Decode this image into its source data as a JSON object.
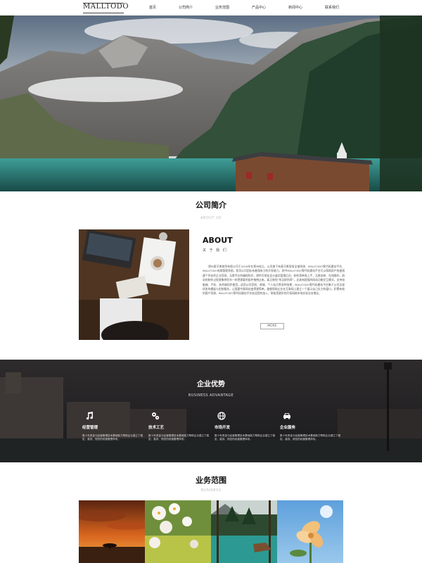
{
  "header": {
    "logo": "MALLTODO",
    "nav": [
      "首页",
      "公司简介",
      "业务范围",
      "产品中心",
      "新闻中心",
      "联系我们"
    ]
  },
  "about": {
    "title": "公司简介",
    "subtitle": "ABOUT US",
    "heading": "ABOUT",
    "heading_cn": "关 于 我 们",
    "body": "郑州麦可希商贸有限公司于2018年在郑州成立，公司旗下有麦可希智慧全域系统、MALLTODO零代码建站平台、MALLTODO电商管理系统。我司公司团队有着强有力的开发能力，其中MALLTODO零代码建站平台可以帮助用户快速搭建个性化的企业官网，无需专业的编程知识，提供可视化设计器及管理后台，制作简单易上手，无需安装、在线操作，网站的制作过程就像拼积木一样把需要的组件拖拽过来，真正做到“所见即所得”，还具有超强的网站功能交互模式，支持电脑端、手机、多终端同步使用，适用公司官网、商城、个人站点等多种场景；MALLTODO零代码建站平台集于公司总部研发的模板与定制服务，让搭建专属网站变得更简单。能够帮助企业在互联网上建立一个展示自己实力的窗口，积累有效的客户资源，MALLTODO零代码建站平台欢迎您的加入，帮助您更好的开拓网络市场实现业务增长。",
    "more": "MORE"
  },
  "advantage": {
    "title": "企业优势",
    "subtitle": "BUSINESS ADVANTAGE",
    "items": [
      {
        "icon": "music-note-icon",
        "name": "经营管理",
        "desc": "数十年资金与经营管理技术基础致力帮助企业建立了稳定、高效、规范的经营管理体系。"
      },
      {
        "icon": "gears-icon",
        "name": "技术工艺",
        "desc": "数十年资金与经营管理技术基础致力帮助企业建立了稳定、高效、规范的经营管理体系。"
      },
      {
        "icon": "globe-icon",
        "name": "市场开发",
        "desc": "数十年资金与经营管理技术基础致力帮助企业建立了稳定、高效、规范的经营管理体系。"
      },
      {
        "icon": "car-icon",
        "name": "企业服务",
        "desc": "数十年资金与经营管理技术基础致力帮助企业建立了稳定、高效、规范的经营管理体系。"
      }
    ]
  },
  "business": {
    "title": "业务范围",
    "subtitle": "BUSINESS"
  }
}
